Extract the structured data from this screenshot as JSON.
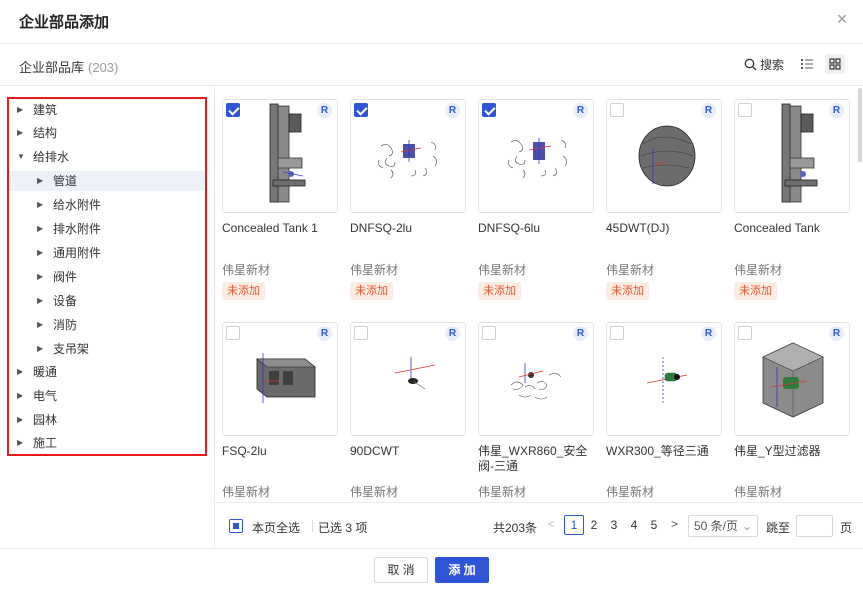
{
  "dialog": {
    "title": "企业部品添加",
    "close_icon": "close-icon"
  },
  "library": {
    "title": "企业部品库",
    "count": "(203)",
    "search_label": "搜索"
  },
  "tree": [
    {
      "label": "建筑",
      "expanded": false
    },
    {
      "label": "结构",
      "expanded": false
    },
    {
      "label": "给排水",
      "expanded": true
    },
    {
      "label": "管道",
      "expanded": false,
      "selected": true
    },
    {
      "label": "给水附件",
      "expanded": false
    },
    {
      "label": "排水附件",
      "expanded": false
    },
    {
      "label": "通用附件",
      "expanded": false
    },
    {
      "label": "阀件",
      "expanded": false
    },
    {
      "label": "设备",
      "expanded": false
    },
    {
      "label": "消防",
      "expanded": false
    },
    {
      "label": "支吊架",
      "expanded": false
    },
    {
      "label": "暖通",
      "expanded": false
    },
    {
      "label": "电气",
      "expanded": false
    },
    {
      "label": "园林",
      "expanded": false
    },
    {
      "label": "施工",
      "expanded": false
    }
  ],
  "items": [
    {
      "name": "Concealed Tank 1",
      "vendor": "伟星新材",
      "status": "未添加",
      "checked": true,
      "badge": "R"
    },
    {
      "name": "DNFSQ-2lu",
      "vendor": "伟星新材",
      "status": "未添加",
      "checked": true,
      "badge": "R"
    },
    {
      "name": "DNFSQ-6lu",
      "vendor": "伟星新材",
      "status": "未添加",
      "checked": true,
      "badge": "R"
    },
    {
      "name": "45DWT(DJ)",
      "vendor": "伟星新材",
      "status": "未添加",
      "checked": false,
      "badge": "R"
    },
    {
      "name": "Concealed Tank",
      "vendor": "伟星新材",
      "status": "未添加",
      "checked": false,
      "badge": "R"
    },
    {
      "name": "FSQ-2lu",
      "vendor": "伟星新材",
      "status": "",
      "checked": false,
      "badge": "R"
    },
    {
      "name": "90DCWT",
      "vendor": "伟星新材",
      "status": "",
      "checked": false,
      "badge": "R"
    },
    {
      "name": "伟星_WXR860_安全阀-三通",
      "vendor": "伟星新材",
      "status": "",
      "checked": false,
      "badge": "R"
    },
    {
      "name": "WXR300_等径三通",
      "vendor": "伟星新材",
      "status": "",
      "checked": false,
      "badge": "R"
    },
    {
      "name": "伟星_Y型过滤器",
      "vendor": "伟星新材",
      "status": "",
      "checked": false,
      "badge": "R"
    }
  ],
  "footer": {
    "select_all_label": "本页全选",
    "selected_text": "已选 3 项",
    "total_text": "共203条",
    "pages": [
      "1",
      "2",
      "3",
      "4",
      "5"
    ],
    "current_page": "1",
    "page_size": "50 条/页",
    "goto_label": "跳至",
    "page_unit": "页"
  },
  "actions": {
    "cancel_label": "取 消",
    "add_label": "添 加"
  },
  "colors": {
    "primary": "#2e54d8",
    "highlight_border": "#e8191c",
    "status_text": "#e05a2b",
    "status_bg": "#fdece4"
  }
}
